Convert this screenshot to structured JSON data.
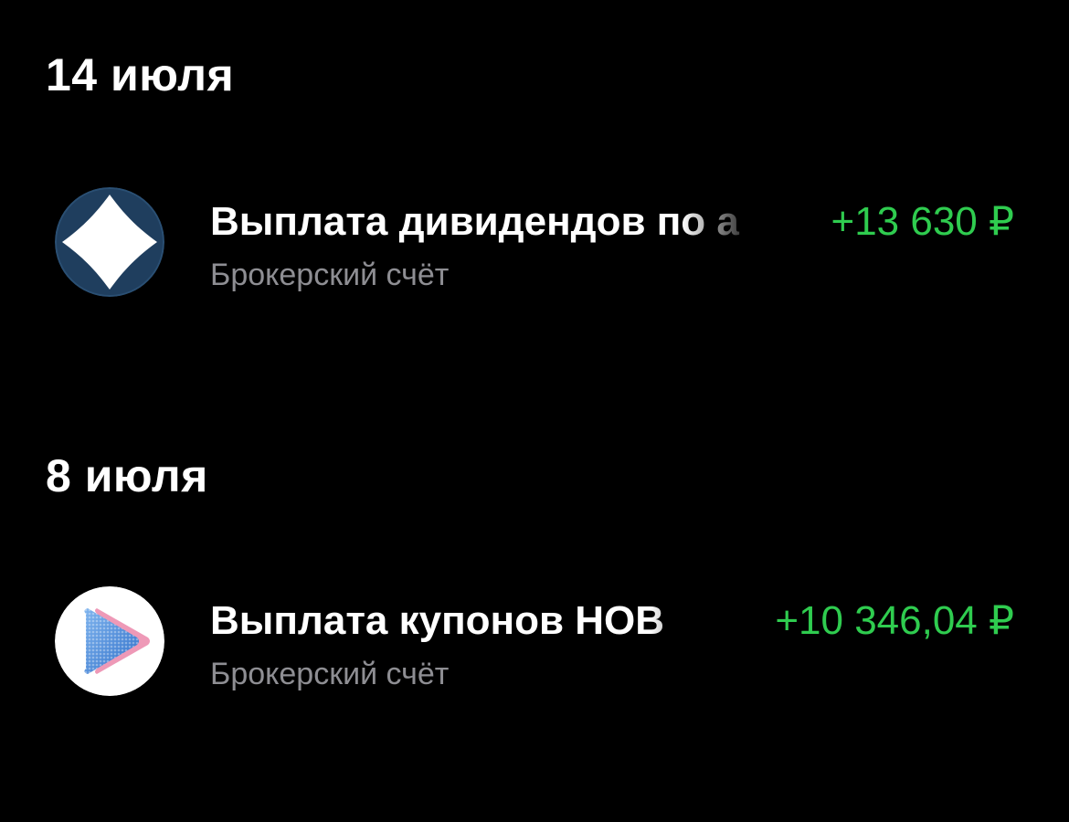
{
  "colors": {
    "background": "#000000",
    "text_primary": "#ffffff",
    "text_secondary": "#8e8e93",
    "amount_positive": "#2fcc4f"
  },
  "groups": [
    {
      "date": "14 июля",
      "operations": [
        {
          "title": "Выплата дивидендов по а",
          "subtitle": "Брокерский счёт",
          "amount": "+13 630 ₽",
          "icon": "diamond-logo-icon"
        }
      ]
    },
    {
      "date": "8 июля",
      "operations": [
        {
          "title": "Выплата купонов НОВ",
          "subtitle": "Брокерский счёт",
          "amount": "+10 346,04 ₽",
          "icon": "play-logo-icon"
        }
      ]
    }
  ]
}
